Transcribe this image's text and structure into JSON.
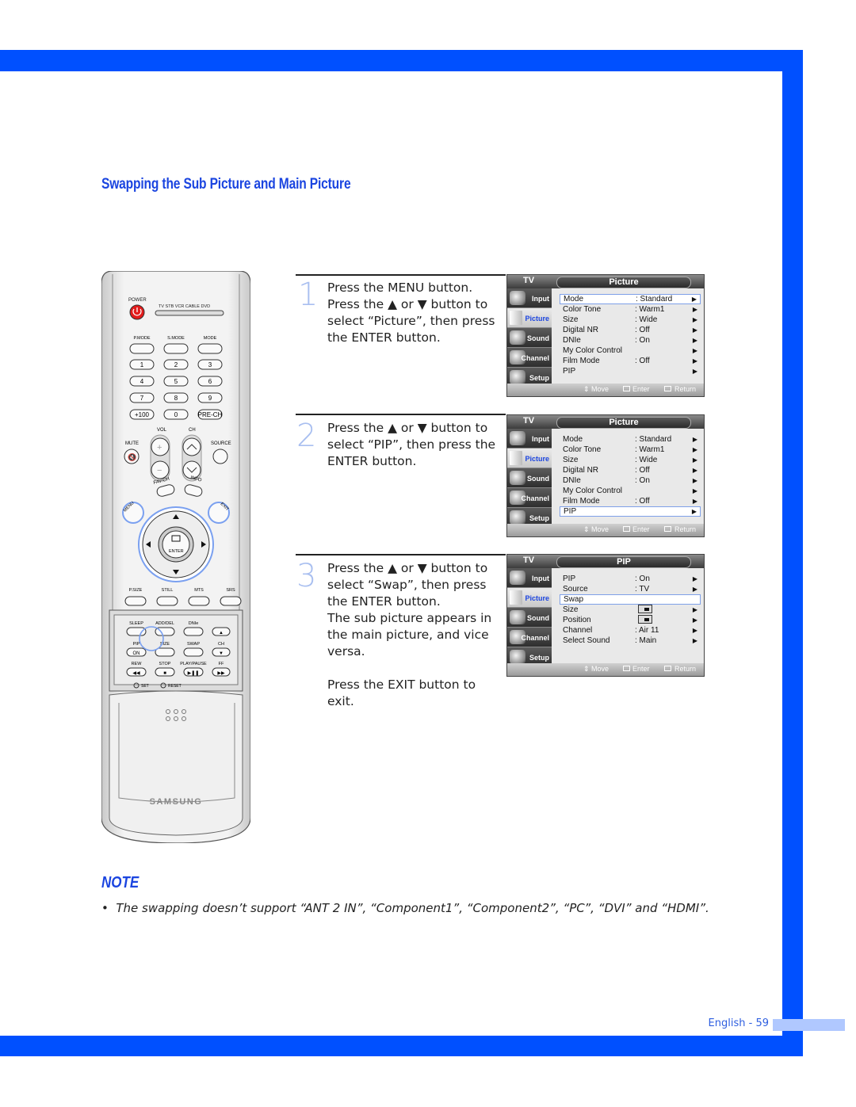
{
  "page": {
    "title": "Swapping the Sub Picture and Main Picture",
    "page_label": "English - 59",
    "accent_color": "#0050ff"
  },
  "steps": [
    {
      "number": "1",
      "lines": [
        "Press the MENU button.",
        "Press the ▲ or ▼ button to",
        "select “Picture”, then press",
        "the ENTER button."
      ]
    },
    {
      "number": "2",
      "lines": [
        "Press the ▲ or ▼ button to",
        "select “PIP”, then press the",
        "ENTER button."
      ]
    },
    {
      "number": "3",
      "lines": [
        "Press the ▲ or ▼ button to",
        "select “Swap”, then press",
        "the ENTER button.",
        "The sub picture appears in",
        "the main picture, and vice",
        "versa.",
        "",
        "Press the EXIT button to exit."
      ]
    }
  ],
  "osd": {
    "tv_label": "TV",
    "side_items": [
      "Input",
      "Picture",
      "Sound",
      "Channel",
      "Setup"
    ],
    "footer": {
      "move": "Move",
      "enter": "Enter",
      "return": "Return"
    },
    "screens": [
      {
        "title": "Picture",
        "active_side": "Picture",
        "selected_row": 0,
        "rows": [
          {
            "label": "Mode",
            "value": ": Standard",
            "arrow": "▶"
          },
          {
            "label": "Color Tone",
            "value": ": Warm1",
            "arrow": "▶"
          },
          {
            "label": "Size",
            "value": ": Wide",
            "arrow": "▶"
          },
          {
            "label": "Digital NR",
            "value": ": Off",
            "arrow": "▶"
          },
          {
            "label": "DNIe",
            "value": ": On",
            "arrow": "▶"
          },
          {
            "label": "My Color Control",
            "value": "",
            "arrow": "▶"
          },
          {
            "label": "Film Mode",
            "value": ": Off",
            "arrow": "▶"
          },
          {
            "label": "PIP",
            "value": "",
            "arrow": "▶"
          }
        ]
      },
      {
        "title": "Picture",
        "active_side": "Picture",
        "selected_row": 7,
        "rows": [
          {
            "label": "Mode",
            "value": ": Standard",
            "arrow": "▶"
          },
          {
            "label": "Color Tone",
            "value": ": Warm1",
            "arrow": "▶"
          },
          {
            "label": "Size",
            "value": ": Wide",
            "arrow": "▶"
          },
          {
            "label": "Digital NR",
            "value": ": Off",
            "arrow": "▶"
          },
          {
            "label": "DNIe",
            "value": ": On",
            "arrow": "▶"
          },
          {
            "label": "My Color Control",
            "value": "",
            "arrow": "▶"
          },
          {
            "label": "Film Mode",
            "value": ": Off",
            "arrow": "▶"
          },
          {
            "label": "PIP",
            "value": "",
            "arrow": "▶"
          }
        ]
      },
      {
        "title": "PIP",
        "active_side": "Picture",
        "selected_row": 2,
        "rows": [
          {
            "label": "PIP",
            "value": ": On",
            "arrow": "▶"
          },
          {
            "label": "Source",
            "value": ": TV",
            "arrow": "▶"
          },
          {
            "label": "Swap",
            "value": "",
            "arrow": ""
          },
          {
            "label": "Size",
            "value": "[size-icon]",
            "arrow": "▶"
          },
          {
            "label": "Position",
            "value": "[position-icon]",
            "arrow": "▶"
          },
          {
            "label": "Channel",
            "value": ": Air 11",
            "arrow": "▶"
          },
          {
            "label": "Select Sound",
            "value": ": Main",
            "arrow": "▶"
          }
        ]
      }
    ]
  },
  "remote": {
    "brand": "SAMSUNG",
    "power": "POWER",
    "modes": [
      "TV",
      "STB",
      "VCR",
      "CABLE",
      "DVD"
    ],
    "mode_buttons": [
      "P.MODE",
      "S.MODE",
      "MODE"
    ],
    "digits": [
      "1",
      "2",
      "3",
      "4",
      "5",
      "6",
      "7",
      "8",
      "9",
      "+100",
      "0",
      "PRE-CH"
    ],
    "vol": "VOL",
    "ch": "CH",
    "mute": "MUTE",
    "source": "SOURCE",
    "fav_ch": "FAV.CH",
    "info": "INFO",
    "menu": "MENU",
    "exit": "EXIT",
    "enter": "ENTER",
    "func_row": [
      "P.SIZE",
      "STILL",
      "MTS",
      "SRS"
    ],
    "lower": [
      "SLEEP",
      "ADD/DEL",
      "DNIe",
      "PIP",
      "SIZE",
      "SWAP",
      "CH",
      "REW",
      "STOP",
      "PLAY/PAUSE",
      "FF"
    ],
    "pip_on": "ON",
    "set": "SET",
    "reset": "RESET"
  },
  "note": {
    "heading": "NOTE",
    "items": [
      "The swapping doesn’t support “ANT 2 IN”, “Component1”, “Component2”, “PC”, “DVI” and “HDMI”."
    ]
  }
}
